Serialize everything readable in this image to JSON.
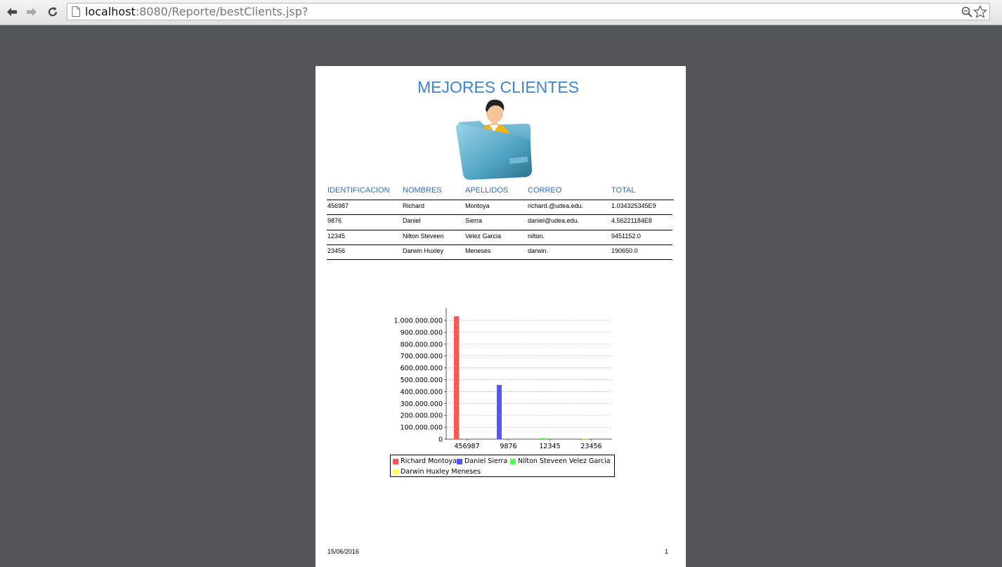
{
  "browser": {
    "url_host": "localhost",
    "url_rest": ":8080/Reporte/bestClients.jsp?"
  },
  "report": {
    "title": "MEJORES CLIENTES",
    "columns": [
      "IDENTIFICACION",
      "NOMBRES",
      "APELLIDOS",
      "CORREO",
      "TOTAL"
    ],
    "rows": [
      [
        "456987",
        "Richard",
        "Montoya",
        "richard.@udea.edu.",
        "1.034325345E9"
      ],
      [
        "9876",
        "Daniel",
        "Sierra",
        "daniel@udea.edu.",
        "4.56221184E8"
      ],
      [
        "12345",
        "Nilton Steveen",
        "Velez Garcia",
        "nilton.",
        "9451152.0"
      ],
      [
        "23456",
        "Darwin Huxley",
        "Meneses",
        "darwin.",
        "190650.0"
      ]
    ],
    "footer": {
      "date": "15/06/2016",
      "page": "1"
    }
  },
  "chart_data": {
    "type": "bar",
    "categories": [
      "456987",
      "9876",
      "12345",
      "23456"
    ],
    "series": [
      {
        "name": "Richard Montoya",
        "color": "#ff5555",
        "values": [
          1034325345,
          0,
          0,
          0
        ]
      },
      {
        "name": "Daniel Sierra",
        "color": "#5555ff",
        "values": [
          0,
          456221184,
          0,
          0
        ]
      },
      {
        "name": "Nilton Steveen Velez Garcia",
        "color": "#55ff55",
        "values": [
          0,
          0,
          9451152,
          0
        ]
      },
      {
        "name": "Darwin Huxley Meneses",
        "color": "#ffff55",
        "values": [
          0,
          0,
          0,
          190650
        ]
      }
    ],
    "yticks": [
      "0",
      "100.000.000",
      "200.000.000",
      "300.000.000",
      "400.000.000",
      "500.000.000",
      "600.000.000",
      "700.000.000",
      "800.000.000",
      "900.000.000",
      "1.000.000.000"
    ],
    "ylim": [
      0,
      1000000000
    ],
    "grid": true,
    "legend_position": "bottom"
  }
}
